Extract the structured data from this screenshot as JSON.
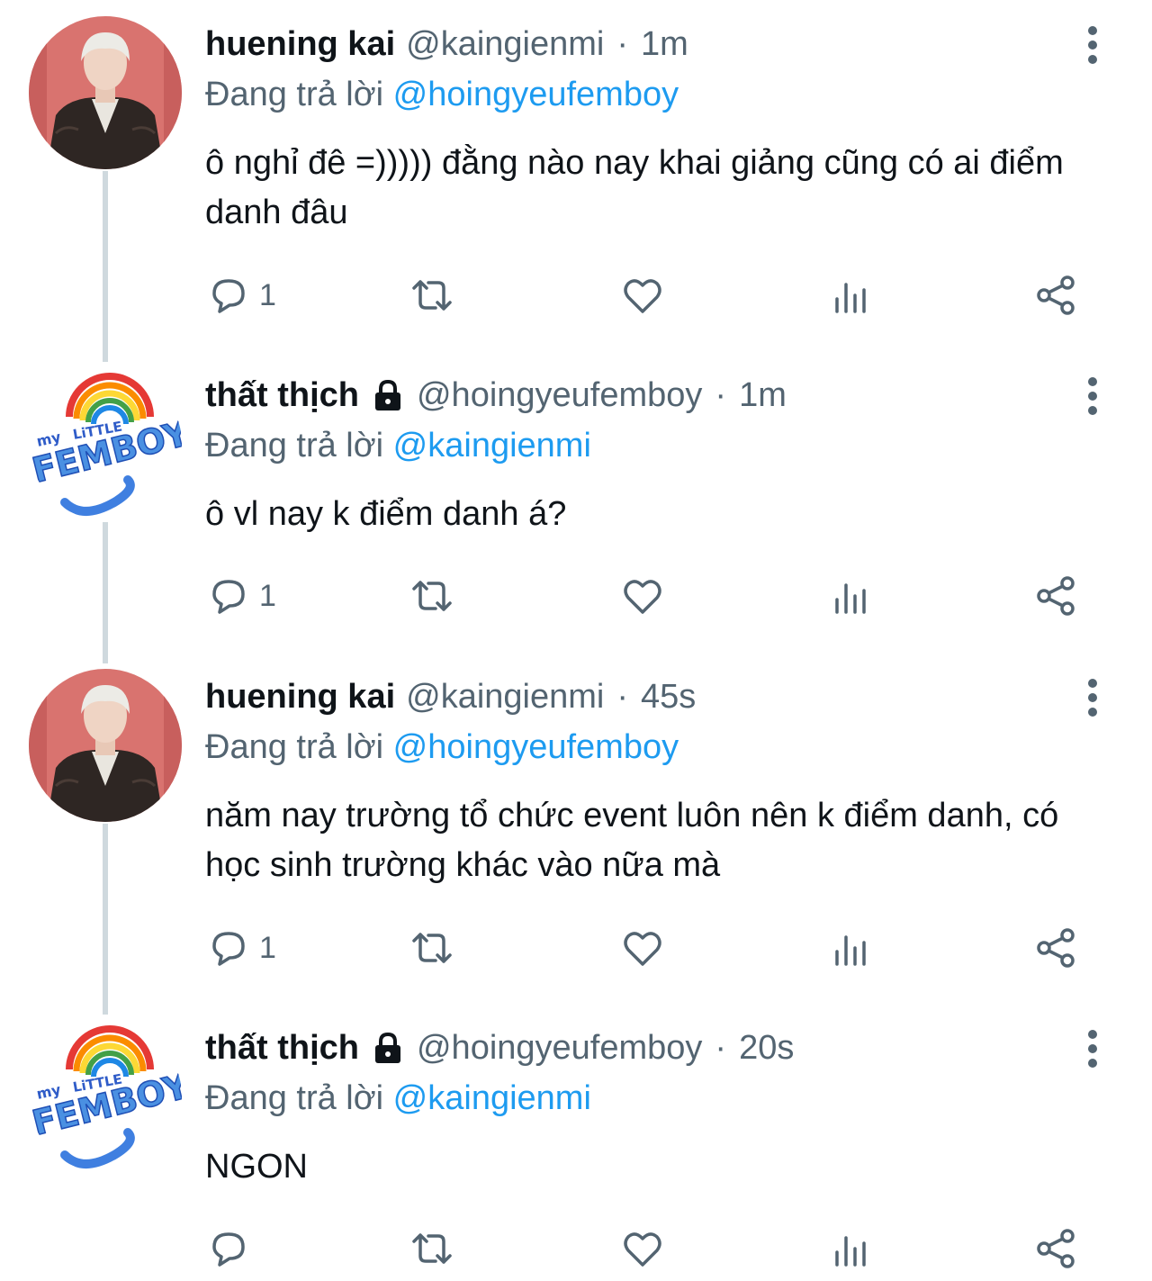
{
  "tweets": [
    {
      "avatar": "photo-avatar",
      "name": "huening kai",
      "locked": false,
      "handle": "@kaingienmi",
      "time": "1m",
      "reply_prefix": "Đang trả lời",
      "reply_to": "@hoingyeufemboy",
      "text": "ô nghỉ đê =))))) đằng nào nay khai giảng cũng có ai điểm danh đâu",
      "reply_count": "1"
    },
    {
      "avatar": "logo-avatar",
      "name": "thất thịch",
      "locked": true,
      "handle": "@hoingyeufemboy",
      "time": "1m",
      "reply_prefix": "Đang trả lời",
      "reply_to": "@kaingienmi",
      "text": "ô vl nay k điểm danh á?",
      "reply_count": "1"
    },
    {
      "avatar": "photo-avatar",
      "name": "huening kai",
      "locked": false,
      "handle": "@kaingienmi",
      "time": "45s",
      "reply_prefix": "Đang trả lời",
      "reply_to": "@hoingyeufemboy",
      "text": "năm nay trường tổ chức event luôn nên k điểm danh, có học sinh trường khác vào nữa mà",
      "reply_count": "1"
    },
    {
      "avatar": "logo-avatar",
      "name": "thất thịch",
      "locked": true,
      "handle": "@hoingyeufemboy",
      "time": "20s",
      "reply_prefix": "Đang trả lời",
      "reply_to": "@kaingienmi",
      "text": "NGON",
      "reply_count": ""
    }
  ],
  "logo_text": "my LiTTLE FEMBOY",
  "dot_separator": "·",
  "colors": {
    "text": "#0f1419",
    "secondary": "#536471",
    "link": "#1d9bf0",
    "thread_line": "#cfd9de"
  },
  "icons": [
    "reply-icon",
    "retweet-icon",
    "like-icon",
    "views-icon",
    "share-icon",
    "more-icon",
    "lock-icon"
  ]
}
